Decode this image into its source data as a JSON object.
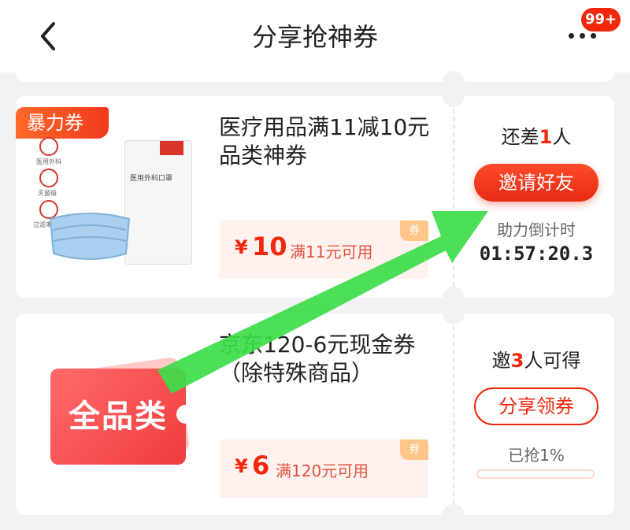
{
  "header": {
    "title": "分享抢神券",
    "badge": "99+",
    "back_icon": "chevron-left-icon",
    "more_icon": "more-dots-icon"
  },
  "coupons": [
    {
      "label": "暴力券",
      "title_line1": "医疗用品满11减10元",
      "title_line2": "品类神券",
      "yen": "¥",
      "amount": "10",
      "condition": "满11元可用",
      "tag": "券",
      "status_prefix": "还差",
      "status_count": "1",
      "status_suffix": "人",
      "button": "邀请好友",
      "timer_label": "助力倒计时",
      "timer": "01:57:20.3",
      "image_label": "医用外科口罩",
      "image_icons": [
        "医用外科",
        "灭菌级",
        "过滤率≥95%"
      ]
    },
    {
      "label": "全品类",
      "title_line1": "京东120-6元现金券",
      "title_line2": "（除特殊商品）",
      "yen": "¥",
      "amount": "6",
      "condition": "满120元可用",
      "tag": "券",
      "status_prefix": "邀",
      "status_count": "3",
      "status_suffix": "人可得",
      "button": "分享领券",
      "progress_text": "已抢1%",
      "progress": 0.01
    }
  ],
  "colors": {
    "accent": "#f2270c",
    "arrow": "#3ddc4a"
  }
}
